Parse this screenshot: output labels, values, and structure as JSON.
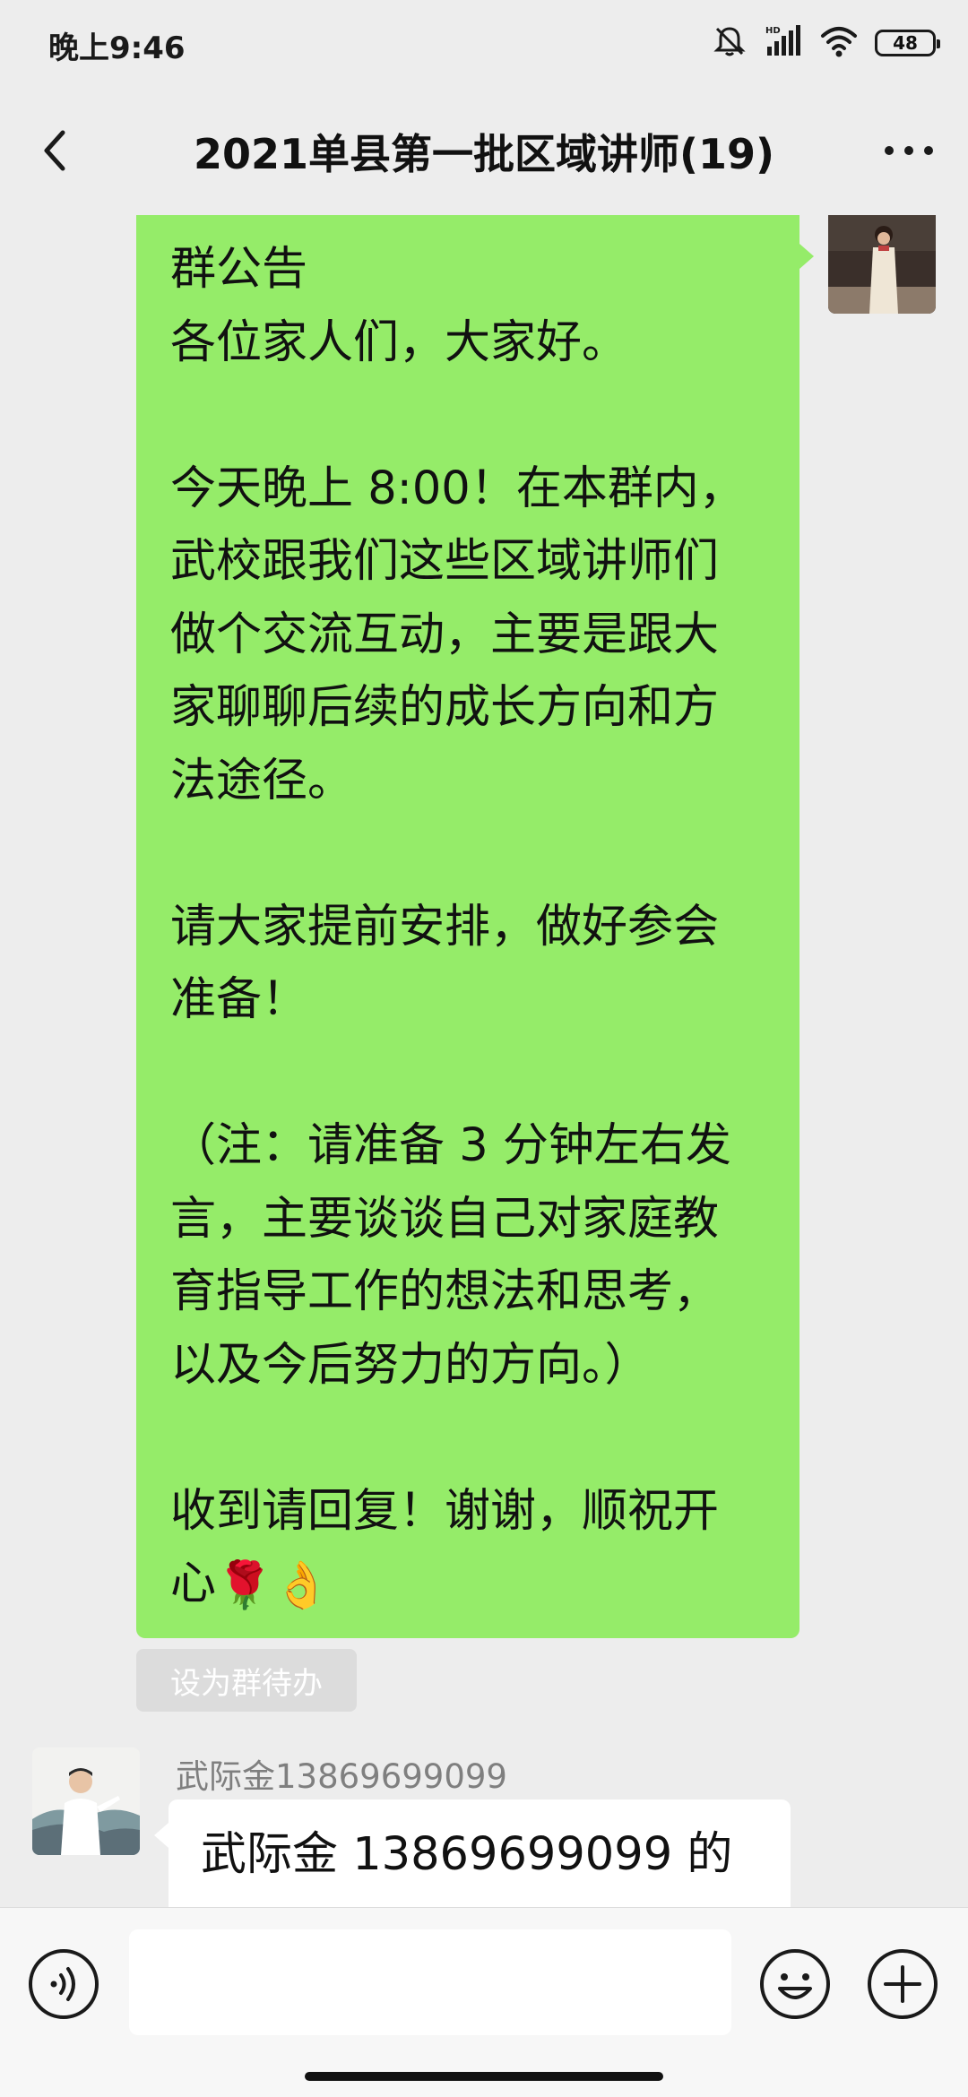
{
  "status_bar": {
    "time": "晚上9:46",
    "battery": "48",
    "icons": [
      "mute-icon",
      "hd-signal-icon",
      "wifi-icon",
      "battery-icon"
    ]
  },
  "nav": {
    "title": "2021单县第一批区域讲师(19)",
    "back_icon": "chevron-left-icon",
    "more_icon": "more-icon"
  },
  "messages": {
    "announcement": {
      "text": "群公告\n各位家人们，大家好。\n\n今天晚上 8:00！在本群内，\n武校跟我们这些区域讲师们\n做个交流互动，主要是跟大\n家聊聊后续的成长方向和方\n法途径。\n\n请大家提前安排，做好参会\n准备！\n\n（注：请准备 3 分钟左右发\n言，主要谈谈自己对家庭教\n育指导工作的想法和思考，\n以及今后努力的方向。）\n\n收到请回复！谢谢，顺祝开\n心",
      "emojis": [
        "🌹",
        "👌"
      ],
      "todo_label": "设为群待办"
    },
    "incoming": {
      "sender": "武际金13869699099",
      "text": "武际金 13869699099 的"
    }
  },
  "input_bar": {
    "placeholder": "",
    "icons": [
      "voice-icon",
      "emoji-icon",
      "plus-icon"
    ]
  },
  "colors": {
    "background": "#ededed",
    "outgoing_bubble": "#95ec69",
    "incoming_bubble": "#ffffff",
    "sender_name": "#7f7f7f"
  }
}
